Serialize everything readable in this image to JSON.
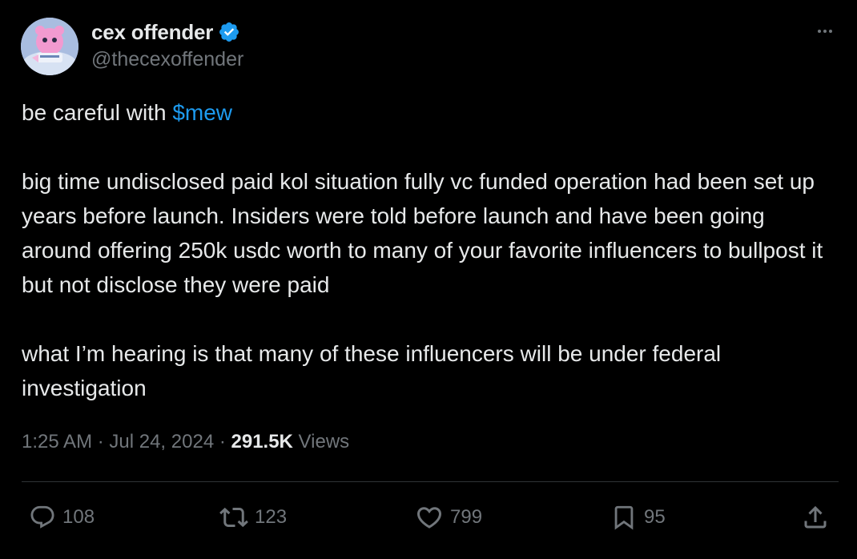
{
  "author": {
    "name": "cex offender",
    "handle": "@thecexoffender"
  },
  "tweet": {
    "line1_prefix": "be careful with ",
    "cashtag": "$mew",
    "paragraph2": "big time undisclosed paid kol situation fully vc funded operation had been set up years before launch. Insiders were told before launch and have been going around offering 250k usdc worth to many of your favorite influencers to bullpost it but not disclose they were paid",
    "paragraph3": "what I’m hearing is that many of these influencers will be under federal investigation"
  },
  "meta": {
    "time": "1:25 AM",
    "separator": " · ",
    "date": "Jul 24, 2024",
    "views_count": "291.5K",
    "views_label": " Views"
  },
  "actions": {
    "replies": "108",
    "reposts": "123",
    "likes": "799",
    "bookmarks": "95"
  },
  "colors": {
    "background": "#000000",
    "text": "#e7e9ea",
    "muted": "#71767b",
    "accent": "#1d9bf0",
    "divider": "#2f3336"
  },
  "icons": {
    "verified": "verified-badge-icon",
    "more": "more-options-icon",
    "reply": "reply-icon",
    "repost": "repost-icon",
    "like": "heart-icon",
    "bookmark": "bookmark-icon",
    "share": "share-icon"
  }
}
